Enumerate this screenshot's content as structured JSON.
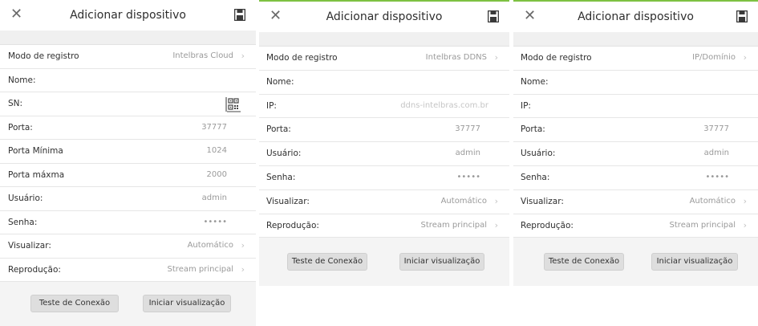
{
  "icons": {
    "close": "close-icon",
    "save": "save-icon",
    "chevron": "chevron-right-icon",
    "qr": "qr-scan-icon"
  },
  "colors": {
    "accent": "#7ec142",
    "background": "#f4f4f4",
    "row": "#ffffff"
  },
  "panels": [
    {
      "title": "Adicionar dispositivo",
      "close_glyph": "✕",
      "rows": [
        {
          "label": "Modo de registro",
          "value": "Intelbras Cloud",
          "chev": "›"
        },
        {
          "label": "Nome:",
          "value": ""
        },
        {
          "label": "SN:",
          "value": ""
        },
        {
          "label": "Porta:",
          "value": "37777"
        },
        {
          "label": "Porta Mínima",
          "value": "1024"
        },
        {
          "label": "Porta máxma",
          "value": "2000"
        },
        {
          "label": "Usuário:",
          "value": "admin"
        },
        {
          "label": "Senha:",
          "value": "•••••"
        },
        {
          "label": "Visualizar:",
          "value": "Automático",
          "chev": "›"
        },
        {
          "label": "Reprodução:",
          "value": "Stream principal",
          "chev": "›"
        }
      ],
      "buttons": {
        "test": "Teste de Conexão",
        "start": "Iniciar visualização"
      }
    },
    {
      "title": "Adicionar dispositivo",
      "close_glyph": "✕",
      "rows": [
        {
          "label": "Modo de registro",
          "value": "Intelbras DDNS",
          "chev": "›"
        },
        {
          "label": "Nome:",
          "value": ""
        },
        {
          "label": "IP:",
          "placeholder": "ddns-intelbras.com.br"
        },
        {
          "label": "Porta:",
          "value": "37777"
        },
        {
          "label": "Usuário:",
          "value": "admin"
        },
        {
          "label": "Senha:",
          "value": "•••••"
        },
        {
          "label": "Visualizar:",
          "value": "Automático",
          "chev": "›"
        },
        {
          "label": "Reprodução:",
          "value": "Stream principal",
          "chev": "›"
        }
      ],
      "buttons": {
        "test": "Teste de Conexão",
        "start": "Iniciar visualização"
      }
    },
    {
      "title": "Adicionar dispositivo",
      "close_glyph": "✕",
      "rows": [
        {
          "label": "Modo de registro",
          "value": "IP/Domínio",
          "chev": "›"
        },
        {
          "label": "Nome:",
          "value": ""
        },
        {
          "label": "IP:",
          "value": ""
        },
        {
          "label": "Porta:",
          "value": "37777"
        },
        {
          "label": "Usuário:",
          "value": "admin"
        },
        {
          "label": "Senha:",
          "value": "•••••"
        },
        {
          "label": "Visualizar:",
          "value": "Automático",
          "chev": "›"
        },
        {
          "label": "Reprodução:",
          "value": "Stream principal",
          "chev": "›"
        }
      ],
      "buttons": {
        "test": "Teste de Conexão",
        "start": "Iniciar visualização"
      }
    }
  ]
}
